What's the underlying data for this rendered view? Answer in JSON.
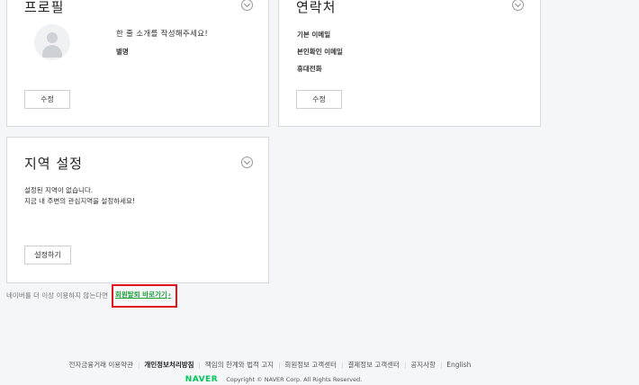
{
  "profile": {
    "title": "프로필",
    "intro": "한 줄 소개를 작성해주세요!",
    "nickname_label": "별명",
    "edit_button": "수정"
  },
  "contact": {
    "title": "연락처",
    "rows": [
      "기본 이메일",
      "본인확인 이메일",
      "휴대전화"
    ],
    "edit_button": "수정"
  },
  "region": {
    "title": "지역 설정",
    "desc_line1": "설정된 지역이 없습니다.",
    "desc_line2": "지금 내 주변의 관심지역을 설정하세요!",
    "set_button": "설정하기"
  },
  "withdraw": {
    "question": "네이버를 더 이상 이용하지 않는다면",
    "link": "회원탈퇴 바로가기",
    "arrow": "›",
    "highlight_color": "#e1141b",
    "link_color": "#20a13e"
  },
  "footer": {
    "links": [
      "전자금융거래 이용약관",
      "개인정보처리방침",
      "책임의 한계와 법적 고지",
      "회원정보 고객센터",
      "결제정보 고객센터",
      "공지사항",
      "English"
    ],
    "bold_index": 1,
    "brand": "NAVER",
    "brand_color": "#03c75a",
    "copyright": "Copyright © NAVER Corp. All Rights Reserved."
  }
}
